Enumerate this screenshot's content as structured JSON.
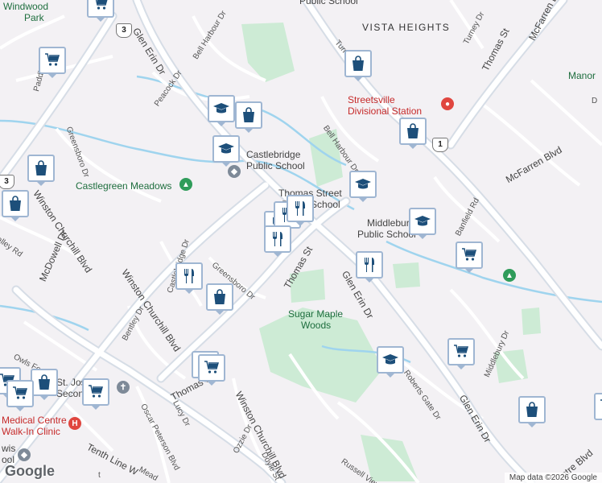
{
  "map": {
    "neighborhoods": {
      "vista_heights": "VISTA HEIGHTS"
    },
    "parks": {
      "windwood_park_line1": "Windwood",
      "windwood_park_line2": "Park",
      "castlegreen_meadows": "Castlegreen Meadows",
      "sugar_maple_woods_line1": "Sugar Maple",
      "sugar_maple_woods_line2": "Woods",
      "manor": "Manor"
    },
    "places": {
      "public_school_top": "Public School",
      "streetsville_line1": "Streetsville",
      "streetsville_line2": "Divisional Station",
      "castlebridge_line1": "Castlebridge",
      "castlebridge_line2": "Public School",
      "thomas_street_line1": "Thomas Street",
      "thomas_street_line2": "Public School",
      "middlebury_line1": "Middlebury",
      "middlebury_line2": "Public School",
      "medical_line1": "Medical Centre",
      "medical_line2": "Walk-In Clinic",
      "st_joseph_line1": "St. Jose",
      "st_joseph_line2": "Secondary",
      "lewis_line1": "wis",
      "lewis_line2": "ool"
    },
    "streets": {
      "glen_erin_dr": "Glen Erin Dr",
      "bell_harbour_dr": "Bell Harbour Dr",
      "peacock_dr": "Peacock Dr",
      "paddle_rd": "Paddle Rd",
      "greensboro_dr": "Greensboro Dr",
      "winston_churchill_blvd": "Winston Churchill Blvd",
      "mcdowell_dr": "McDowell Dr",
      "castlebridge_dr": "Castlebridge Dr",
      "thomas_st": "Thomas St",
      "mcfarren_blvd": "McFarren Blvd",
      "turney_dr": "Turney Dr",
      "banfield_rd": "Banfield Rd",
      "middlebury_dr": "Middlebury Dr",
      "roberts_gate_dr": "Roberts Gate Dr",
      "russell_view_dr": "Russell View Dr",
      "tenth_line_w": "Tenth Line W",
      "owls_foot_dr": "Owls Foot Dr",
      "bentley_dr": "Bentley Dr",
      "lucy_dr": "Lucy Dr",
      "oscar_peterson_blvd": "Oscar Peterson Blvd",
      "ozzie_dr": "Ozzie Dr",
      "doyle_st": "Doyle St",
      "valley_rd": "alley Rd",
      "meadow": "Mead",
      "centre_blvd": "ntre Blvd",
      "manor_fragment": "D",
      "tenth_line_fragment": "t"
    },
    "route_shields": {
      "route_3": "3",
      "route_1": "1"
    },
    "pin_symbols": {
      "hospital": "H"
    },
    "markers": [
      {
        "type": "shopping-cart",
        "icon": "shopping-cart-icon"
      },
      {
        "type": "shopping-cart",
        "icon": "shopping-cart-icon"
      },
      {
        "type": "shopping-bag",
        "icon": "shopping-bag-icon"
      },
      {
        "type": "school",
        "icon": "school-icon"
      },
      {
        "type": "shopping-bag",
        "icon": "shopping-bag-icon"
      },
      {
        "type": "school",
        "icon": "school-icon"
      },
      {
        "type": "shopping-bag",
        "icon": "shopping-bag-icon"
      },
      {
        "type": "shopping-bag",
        "icon": "shopping-bag-icon"
      },
      {
        "type": "shopping-bag",
        "icon": "shopping-bag-icon"
      },
      {
        "type": "school",
        "icon": "school-icon"
      },
      {
        "type": "restaurant",
        "icon": "fork-knife-icon"
      },
      {
        "type": "restaurant",
        "icon": "fork-knife-icon"
      },
      {
        "type": "restaurant",
        "icon": "fork-knife-icon"
      },
      {
        "type": "school",
        "icon": "school-icon"
      },
      {
        "type": "shopping-cart",
        "icon": "shopping-cart-icon"
      },
      {
        "type": "restaurant",
        "icon": "fork-knife-icon"
      },
      {
        "type": "restaurant",
        "icon": "fork-knife-icon"
      },
      {
        "type": "shopping-bag",
        "icon": "shopping-bag-icon"
      },
      {
        "type": "shopping-cart",
        "icon": "shopping-cart-icon"
      },
      {
        "type": "school",
        "icon": "school-icon"
      },
      {
        "type": "restaurant",
        "icon": "fork-knife-icon"
      },
      {
        "type": "restaurant",
        "icon": "fork-knife-icon"
      },
      {
        "type": "shopping-cart",
        "icon": "shopping-cart-icon"
      },
      {
        "type": "shopping-bag",
        "icon": "shopping-bag-icon"
      },
      {
        "type": "shopping-cart",
        "icon": "shopping-cart-icon"
      },
      {
        "type": "shopping-cart",
        "icon": "shopping-cart-icon"
      },
      {
        "type": "shopping-bag",
        "icon": "shopping-bag-icon"
      },
      {
        "type": "shopping-cart",
        "icon": "shopping-cart-icon"
      },
      {
        "type": "shopping-cart",
        "icon": "shopping-cart-icon"
      }
    ]
  },
  "footer": {
    "logo": "Google",
    "attribution": "Map data ©2026 Google"
  }
}
